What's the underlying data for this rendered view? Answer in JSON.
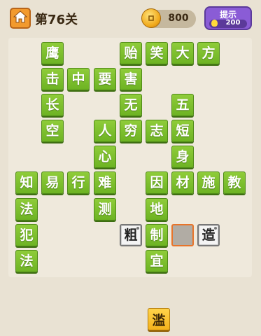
{
  "header": {
    "level_title": "第76关",
    "coins": "800",
    "hint_label": "提示",
    "hint_cost": "200"
  },
  "colors": {
    "given_tile": "#7abf2c",
    "selected_outline": "#e8742a",
    "hint_button": "#8a5cd6",
    "choice_tile": "#f7c234"
  },
  "board": {
    "cells": [
      {
        "char": "鹰",
        "state": "given"
      },
      {
        "char": "贻",
        "state": "given"
      },
      {
        "char": "笑",
        "state": "given"
      },
      {
        "char": "大",
        "state": "given"
      },
      {
        "char": "方",
        "state": "given"
      },
      {
        "char": "击",
        "state": "given"
      },
      {
        "char": "中",
        "state": "given"
      },
      {
        "char": "要",
        "state": "given"
      },
      {
        "char": "害",
        "state": "given"
      },
      {
        "char": "长",
        "state": "given"
      },
      {
        "char": "无",
        "state": "given"
      },
      {
        "char": "五",
        "state": "given"
      },
      {
        "char": "空",
        "state": "given"
      },
      {
        "char": "人",
        "state": "given"
      },
      {
        "char": "穷",
        "state": "given"
      },
      {
        "char": "志",
        "state": "given"
      },
      {
        "char": "短",
        "state": "given"
      },
      {
        "char": "心",
        "state": "given"
      },
      {
        "char": "身",
        "state": "given"
      },
      {
        "char": "知",
        "state": "given"
      },
      {
        "char": "易",
        "state": "given"
      },
      {
        "char": "行",
        "state": "given"
      },
      {
        "char": "难",
        "state": "given"
      },
      {
        "char": "因",
        "state": "given"
      },
      {
        "char": "材",
        "state": "given"
      },
      {
        "char": "施",
        "state": "given"
      },
      {
        "char": "教",
        "state": "given"
      },
      {
        "char": "法",
        "state": "given"
      },
      {
        "char": "测",
        "state": "given"
      },
      {
        "char": "地",
        "state": "given"
      },
      {
        "char": "犯",
        "state": "given"
      },
      {
        "char": "粗",
        "state": "filled"
      },
      {
        "char": "制",
        "state": "given"
      },
      {
        "char": "",
        "state": "empty"
      },
      {
        "char": "造",
        "state": "filled"
      },
      {
        "char": "法",
        "state": "given"
      },
      {
        "char": "宜",
        "state": "given"
      }
    ]
  },
  "choices": [
    "滥"
  ]
}
